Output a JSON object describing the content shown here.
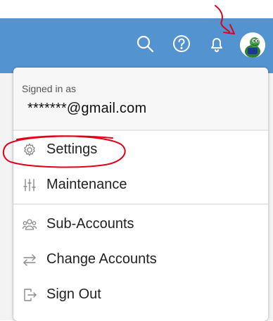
{
  "header": {
    "background_color": "#5393cf",
    "icons": {
      "search": "search-icon",
      "help": "help-icon",
      "notifications": "bell-icon",
      "avatar": "avatar"
    }
  },
  "menu": {
    "signed_in_label": "Signed in as",
    "email": "*******@gmail.com",
    "items": [
      {
        "label": "Settings",
        "icon": "gear-icon"
      },
      {
        "label": "Maintenance",
        "icon": "sliders-icon"
      },
      {
        "label": "Sub-Accounts",
        "icon": "users-icon"
      },
      {
        "label": "Change Accounts",
        "icon": "swap-arrows-icon"
      },
      {
        "label": "Sign Out",
        "icon": "sign-out-icon"
      }
    ]
  },
  "annotation_color": "#e0001a"
}
